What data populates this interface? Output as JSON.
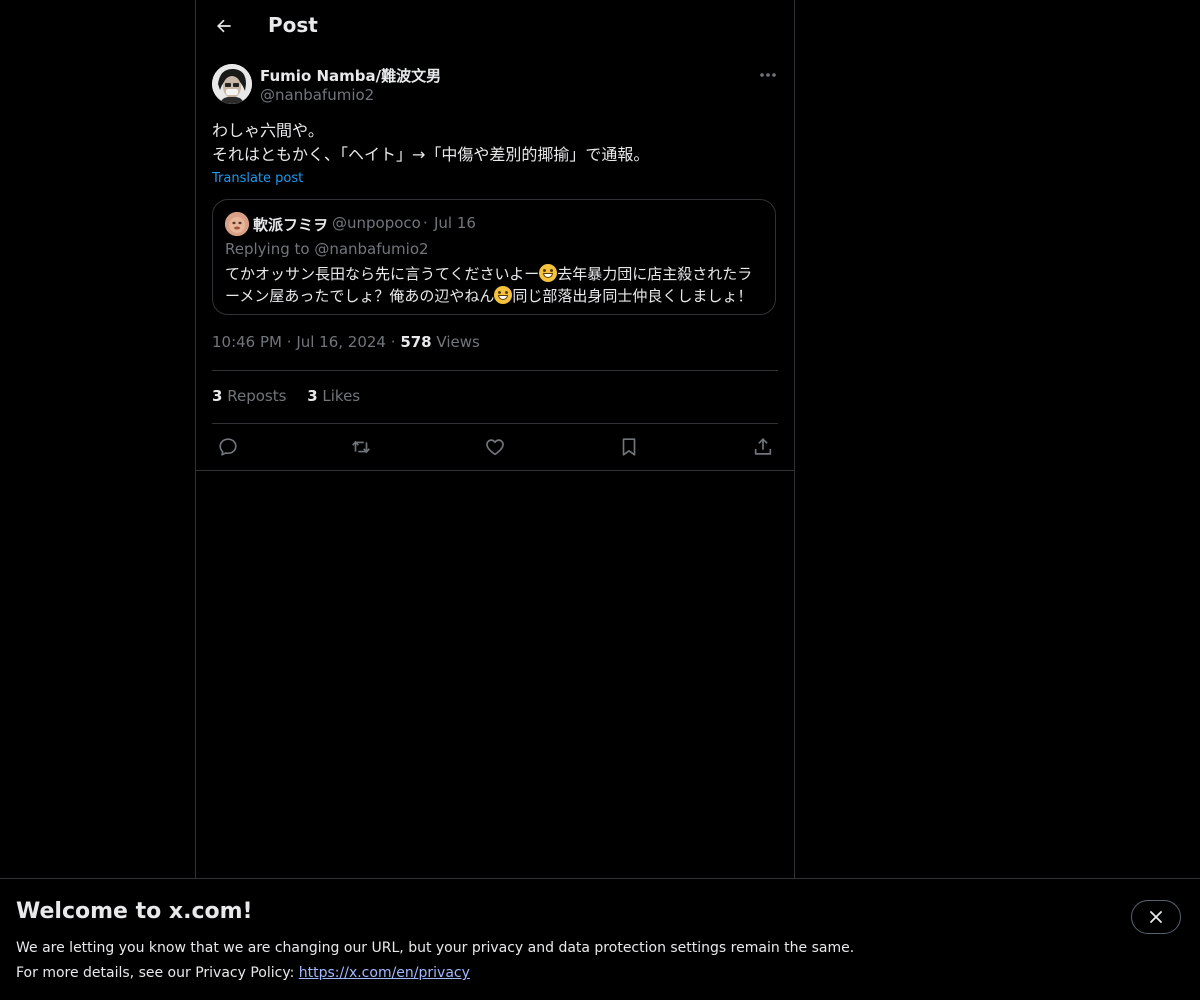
{
  "header": {
    "title": "Post"
  },
  "post": {
    "author_name": "Fumio Namba/難波文男",
    "author_handle": "@nanbafumio2",
    "text_line1": "わしゃ六間や。",
    "text_line2": "それはともかく、「ヘイト」→「中傷や差別的揶揄」で通報。",
    "translate_label": "Translate post",
    "time": "10:46 PM",
    "date": "Jul 16, 2024",
    "views_count": "578",
    "views_label": "Views",
    "reposts_count": "3",
    "reposts_label": "Reposts",
    "likes_count": "3",
    "likes_label": "Likes"
  },
  "quote": {
    "author_name": "軟派フミヲ",
    "author_handle": "@unpopoco",
    "date": "Jul 16",
    "replying_to": "Replying to @nanbafumio2",
    "text_part1": "てかオッサン長田なら先に言うてくださいよー",
    "text_part2": "去年暴力団に店主殺されたラーメン屋あったでしょ？俺あの辺やねん",
    "text_part3": "同じ部落出身同士仲良くしましょ！",
    "emoji_name": "grinning-face-emoji"
  },
  "actions": {
    "icons": [
      "reply-icon",
      "repost-icon",
      "like-icon",
      "bookmark-icon",
      "share-icon"
    ]
  },
  "banner": {
    "title": "Welcome to x.com!",
    "line1": "We are letting you know that we are changing our URL, but your privacy and data protection settings remain the same.",
    "line2_prefix": "For more details, see our Privacy Policy: ",
    "link": "https://x.com/en/privacy"
  },
  "colors": {
    "background": "#000000",
    "text": "#e7e9ea",
    "muted": "#71767b",
    "border": "#2f3336",
    "accent": "#1d9bf0"
  }
}
